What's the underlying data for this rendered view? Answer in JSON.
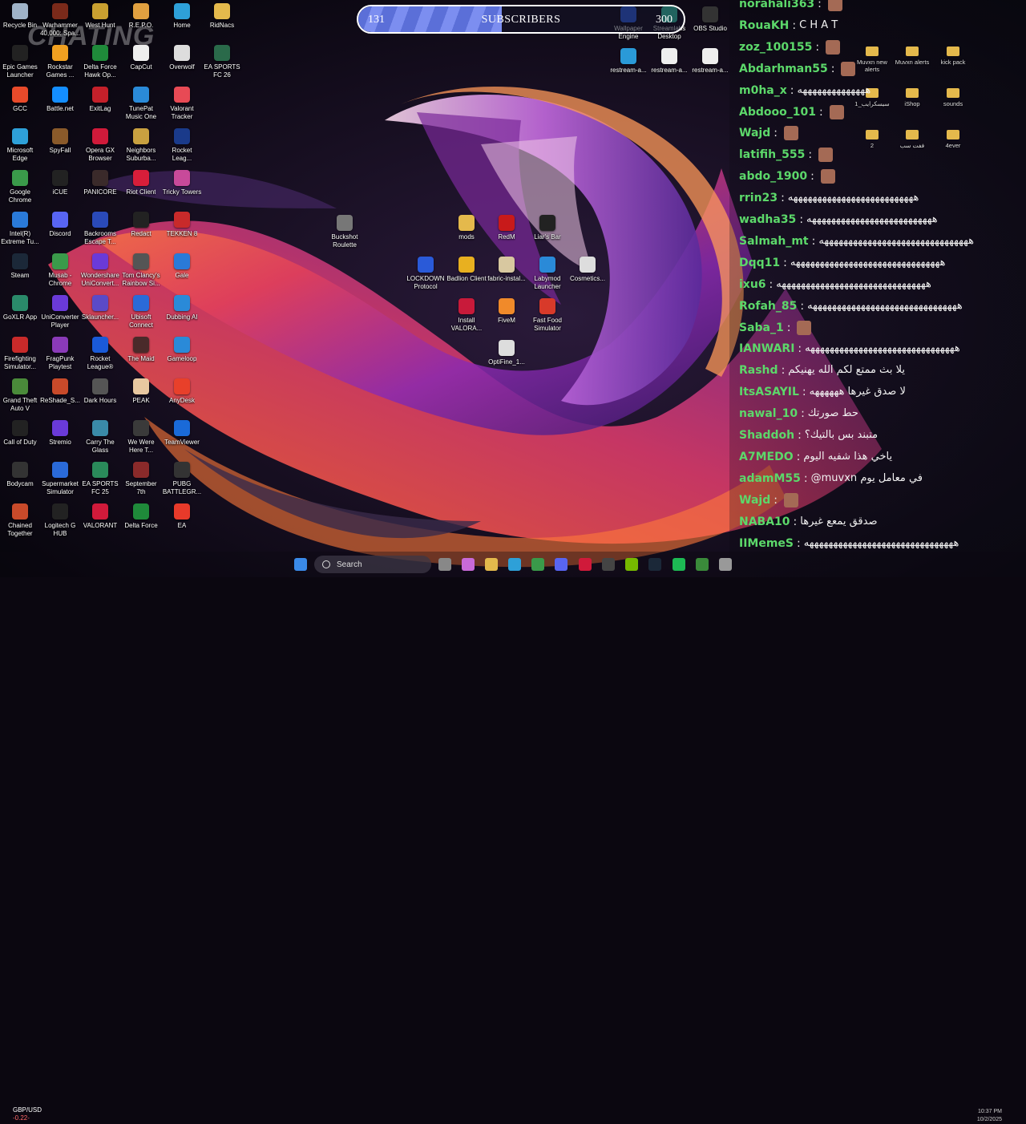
{
  "desktop": {
    "overlay_text": "CHATING",
    "icons": [
      {
        "label": "Recycle Bin",
        "icon": "recycle-bin-icon",
        "color": "#9fb3c8"
      },
      {
        "label": "Warhammer 40,000: Spa...",
        "icon": "warhammer-icon",
        "color": "#7a2a1a"
      },
      {
        "label": "West Hunt",
        "icon": "west-hunt-icon",
        "color": "#c9a030"
      },
      {
        "label": "R.E.P.O.",
        "icon": "repo-icon",
        "color": "#e0a040"
      },
      {
        "label": "Home",
        "icon": "edge-home-icon",
        "color": "#2ea0d8"
      },
      {
        "label": "RidNacs",
        "icon": "folder-icon",
        "color": "#e4b94c"
      },
      {
        "label": "Epic Games Launcher",
        "icon": "epic-games-icon",
        "color": "#222"
      },
      {
        "label": "Rockstar Games ...",
        "icon": "rockstar-icon",
        "color": "#f0a020"
      },
      {
        "label": "Delta Force Hawk Op...",
        "icon": "delta-force-icon",
        "color": "#1f8a3a"
      },
      {
        "label": "CapCut",
        "icon": "capcut-icon",
        "color": "#eee"
      },
      {
        "label": "Overwolf",
        "icon": "overwolf-icon",
        "color": "#ddd"
      },
      {
        "label": "EA SPORTS FC 26",
        "icon": "ea-fc-icon",
        "color": "#2a6a4a"
      },
      {
        "label": "GCC",
        "icon": "gcc-icon",
        "color": "#e84a2a"
      },
      {
        "label": "Battle.net",
        "icon": "battlenet-icon",
        "color": "#148eff"
      },
      {
        "label": "ExitLag",
        "icon": "exitlag-icon",
        "color": "#c4202a"
      },
      {
        "label": "TunePat Music One",
        "icon": "tunepat-icon",
        "color": "#2a8ad8"
      },
      {
        "label": "Valorant Tracker",
        "icon": "valorant-tracker-icon",
        "color": "#e84a55"
      },
      {
        "label": "Microsoft Edge",
        "icon": "edge-icon",
        "color": "#2ea0d8"
      },
      {
        "label": "SpyFall",
        "icon": "spyfall-icon",
        "color": "#8a5a2a"
      },
      {
        "label": "Opera GX Browser",
        "icon": "opera-gx-icon",
        "color": "#d01a3a"
      },
      {
        "label": "Neighbors Suburba...",
        "icon": "neighbors-icon",
        "color": "#c8a040"
      },
      {
        "label": "Rocket Leag...",
        "icon": "rocket-league-icon",
        "color": "#1a3a8a"
      },
      {
        "label": "Google Chrome",
        "icon": "chrome-icon",
        "color": "#3a9a4a"
      },
      {
        "label": "iCUE",
        "icon": "icue-icon",
        "color": "#222"
      },
      {
        "label": "PANICORE",
        "icon": "panicore-icon",
        "color": "#3a2a2a"
      },
      {
        "label": "Riot Client",
        "icon": "riot-client-icon",
        "color": "#d81e3a"
      },
      {
        "label": "Tricky Towers",
        "icon": "tricky-towers-icon",
        "color": "#c84a9a"
      },
      {
        "label": "Intel(R) Extreme Tu...",
        "icon": "intel-icon",
        "color": "#2a7ad8"
      },
      {
        "label": "Discord",
        "icon": "discord-icon",
        "color": "#5865f2"
      },
      {
        "label": "Backrooms Escape T...",
        "icon": "backrooms-icon",
        "color": "#2a4ab8"
      },
      {
        "label": "Redact",
        "icon": "redact-icon",
        "color": "#222"
      },
      {
        "label": "TEKKEN 8",
        "icon": "tekken-icon",
        "color": "#c82a2a"
      },
      {
        "label": "Steam",
        "icon": "steam-icon",
        "color": "#1b2838"
      },
      {
        "label": "Musab - Chrome",
        "icon": "chrome-profile-icon",
        "color": "#3a9a4a"
      },
      {
        "label": "Wondershare UniConvert...",
        "icon": "uniconverter-icon",
        "color": "#6a3ad8"
      },
      {
        "label": "Tom Clancy's Rainbow Si...",
        "icon": "rainbow-six-icon",
        "color": "#555"
      },
      {
        "label": "Gale",
        "icon": "gale-icon",
        "color": "#2a7ad8"
      },
      {
        "label": "GoXLR App",
        "icon": "goxlr-icon",
        "color": "#2a8a6a"
      },
      {
        "label": "UniConverter Player",
        "icon": "uniconverter-player-icon",
        "color": "#6a3ad8"
      },
      {
        "label": "Sklauncher...",
        "icon": "sklauncher-icon",
        "color": "#5a4ac8"
      },
      {
        "label": "Ubisoft Connect",
        "icon": "ubisoft-icon",
        "color": "#2a6ad8"
      },
      {
        "label": "Dubbing AI",
        "icon": "dubbing-ai-icon",
        "color": "#2a8ad8"
      },
      {
        "label": "Firefighting Simulator...",
        "icon": "firefighting-icon",
        "color": "#c82a2a"
      },
      {
        "label": "FragPunk Playtest",
        "icon": "fragpunk-icon",
        "color": "#8a3ab8"
      },
      {
        "label": "Rocket League®",
        "icon": "rocket-league-2-icon",
        "color": "#1a5ad8"
      },
      {
        "label": "The Maid",
        "icon": "the-maid-icon",
        "color": "#4a2a2a"
      },
      {
        "label": "Gameloop",
        "icon": "gameloop-icon",
        "color": "#2a8ad8"
      },
      {
        "label": "Grand Theft Auto V",
        "icon": "gta-icon",
        "color": "#4a8a3a"
      },
      {
        "label": "ReShade_S...",
        "icon": "reshade-icon",
        "color": "#c84a2a"
      },
      {
        "label": "Dark Hours",
        "icon": "dark-hours-icon",
        "color": "#555"
      },
      {
        "label": "PEAK",
        "icon": "peak-icon",
        "color": "#e8c8a0"
      },
      {
        "label": "AnyDesk",
        "icon": "anydesk-icon",
        "color": "#e8402a"
      },
      {
        "label": "Call of Duty",
        "icon": "call-of-duty-icon",
        "color": "#222"
      },
      {
        "label": "Stremio",
        "icon": "stremio-icon",
        "color": "#6a3ad8"
      },
      {
        "label": "Carry The Glass",
        "icon": "carry-glass-icon",
        "color": "#3a8aa8"
      },
      {
        "label": "We Were Here T...",
        "icon": "we-were-here-icon",
        "color": "#3a3a3a"
      },
      {
        "label": "TeamViewer",
        "icon": "teamviewer-icon",
        "color": "#1a6ad8"
      },
      {
        "label": "Bodycam",
        "icon": "bodycam-icon",
        "color": "#333"
      },
      {
        "label": "Supermarket Simulator",
        "icon": "supermarket-icon",
        "color": "#2a6ad8"
      },
      {
        "label": "EA SPORTS FC 25",
        "icon": "ea-fc25-icon",
        "color": "#2a8a5a"
      },
      {
        "label": "September 7th",
        "icon": "september-icon",
        "color": "#8a2a2a"
      },
      {
        "label": "PUBG BATTLEGR...",
        "icon": "pubg-icon",
        "color": "#333"
      },
      {
        "label": "Chained Together",
        "icon": "chained-together-icon",
        "color": "#c84a2a"
      },
      {
        "label": "Logitech G HUB",
        "icon": "logitech-icon",
        "color": "#222"
      },
      {
        "label": "VALORANT",
        "icon": "valorant-icon",
        "color": "#d01a3a"
      },
      {
        "label": "Delta Force",
        "icon": "delta-force-2-icon",
        "color": "#1f8a3a"
      },
      {
        "label": "EA",
        "icon": "ea-icon",
        "color": "#e83a2a"
      }
    ],
    "center_icons": [
      {
        "label": "Buckshot Roulette",
        "icon": "buckshot-icon",
        "color": "#777"
      },
      {
        "label": "mods",
        "icon": "folder-icon",
        "color": "#e4b94c"
      },
      {
        "label": "RedM",
        "icon": "redm-icon",
        "color": "#c81a1a"
      },
      {
        "label": "Liar's Bar",
        "icon": "liars-bar-icon",
        "color": "#222"
      },
      {
        "label": "LOCKDOWN Protocol",
        "icon": "lockdown-icon",
        "color": "#2a5ad8"
      },
      {
        "label": "Badlion Client",
        "icon": "badlion-icon",
        "color": "#e8b020"
      },
      {
        "label": "fabric-instal...",
        "icon": "fabric-icon",
        "color": "#d8c8a0"
      },
      {
        "label": "Labymod Launcher",
        "icon": "labymod-icon",
        "color": "#2a8ad8"
      },
      {
        "label": "Cosmetics...",
        "icon": "cosmetics-icon",
        "color": "#ddd"
      },
      {
        "label": "Install VALORA...",
        "icon": "install-valorant-icon",
        "color": "#c81a3a"
      },
      {
        "label": "FiveM",
        "icon": "fivem-icon",
        "color": "#f08a2a"
      },
      {
        "label": "Fast Food Simulator",
        "icon": "fast-food-icon",
        "color": "#d83a2a"
      },
      {
        "label": "OptiFine_1...",
        "icon": "optifine-icon",
        "color": "#ddd"
      }
    ],
    "top_right_icons": [
      {
        "label": "Wallpaper Engine",
        "icon": "wallpaper-engine-icon",
        "color": "#2a5ad8"
      },
      {
        "label": "Streamlabs Desktop",
        "icon": "streamlabs-icon",
        "color": "#31c3a2"
      },
      {
        "label": "OBS Studio",
        "icon": "obs-icon",
        "color": "#333"
      },
      {
        "label": "restream-a...",
        "icon": "restream-icon",
        "color": "#2a9ad8"
      },
      {
        "label": "restream-a...",
        "icon": "file-icon",
        "color": "#eee"
      },
      {
        "label": "restream-a...",
        "icon": "file-icon",
        "color": "#eee"
      }
    ]
  },
  "subscribers": {
    "count": "131",
    "label": "SUBSCRIBERS",
    "goal": "300",
    "progress": 0.44
  },
  "chat": {
    "messages": [
      {
        "user": "norahali363",
        "color": "#5cd86a",
        "text": ""
      },
      {
        "user": "RouaKH",
        "color": "#5cd86a",
        "text": "C H A T"
      },
      {
        "user": "zoz_100155",
        "color": "#5cd86a",
        "text": ""
      },
      {
        "user": "Abdarhman55",
        "color": "#5cd86a",
        "text": ""
      },
      {
        "user": "m0ha_x",
        "color": "#5cd86a",
        "text": "ههههههههههههههه"
      },
      {
        "user": "Abdooo_101",
        "color": "#5cd86a",
        "text": ""
      },
      {
        "user": "Wajd",
        "color": "#5cd86a",
        "text": ""
      },
      {
        "user": "latifih_555",
        "color": "#5cd86a",
        "text": ""
      },
      {
        "user": "abdo_1900",
        "color": "#5cd86a",
        "text": ""
      },
      {
        "user": "rrin23",
        "color": "#5cd86a",
        "text": "ههههههههههههههههههههههههههه"
      },
      {
        "user": "wadha35",
        "color": "#5cd86a",
        "text": "ههههههههههههههههههههههههههه"
      },
      {
        "user": "Salmah_mt",
        "color": "#5cd86a",
        "text": "هههههههههههههههههههههههههههههههه"
      },
      {
        "user": "Dqq11",
        "color": "#5cd86a",
        "text": "هههههههههههههههههههههههههههههههه"
      },
      {
        "user": "ixu6",
        "color": "#5cd86a",
        "text": "هههههههههههههههههههههههههههههههه"
      },
      {
        "user": "Rofah_85",
        "color": "#5cd86a",
        "text": "هههههههههههههههههههههههههههههههه"
      },
      {
        "user": "Saba_1",
        "color": "#5cd86a",
        "text": ""
      },
      {
        "user": "IANWARI",
        "color": "#5cd86a",
        "text": "هههههههههههههههههههههههههههههههه"
      },
      {
        "user": "Rashd",
        "color": "#5cd86a",
        "text": "يلا بث ممتع لكم الله يهنيكم"
      },
      {
        "user": "ItsASAYIL",
        "color": "#5cd86a",
        "text": "لا صدق غيرها ههههههه"
      },
      {
        "user": "nawal_10",
        "color": "#5cd86a",
        "text": "حط صورتك"
      },
      {
        "user": "Shaddoh",
        "color": "#5cd86a",
        "text": "متبند بس بالتيك؟"
      },
      {
        "user": "A7MEDO",
        "color": "#5cd86a",
        "text": "ياخي هذا شفيه اليوم"
      },
      {
        "user": "adamM55",
        "color": "#5cd86a",
        "text": "@muvxn في معامل يوم"
      },
      {
        "user": "Wajd",
        "color": "#5cd86a",
        "text": ""
      },
      {
        "user": "NABA10",
        "color": "#5cd86a",
        "text": "صدقق يمعع غيرها"
      },
      {
        "user": "IIMemeS",
        "color": "#5cd86a",
        "text": "هههههههههههههههههههههههههههههههه"
      }
    ],
    "folders": [
      {
        "label": "Muvxn new alerts"
      },
      {
        "label": "Muvxn alerts"
      },
      {
        "label": "kick pack"
      },
      {
        "label": "سيسكرايب_1"
      },
      {
        "label": "iShop"
      },
      {
        "label": "sounds"
      },
      {
        "label": "2"
      },
      {
        "label": "ففت سب"
      },
      {
        "label": "4ever"
      }
    ]
  },
  "taskbar": {
    "weather_title": "GBP/USD",
    "weather_value": "-0.22-",
    "search_placeholder": "Search",
    "clock_time": "10:37 PM",
    "clock_date": "10/2/2025",
    "apps": [
      "windows-start-icon",
      "widgets-icon",
      "task-view-icon",
      "copilot-icon",
      "file-explorer-icon",
      "edge-icon",
      "chrome-icon",
      "discord-icon",
      "valorant-icon",
      "obs-icon",
      "nvidia-icon",
      "steam-icon",
      "spotify-icon",
      "xbox-icon",
      "settings-icon"
    ]
  }
}
